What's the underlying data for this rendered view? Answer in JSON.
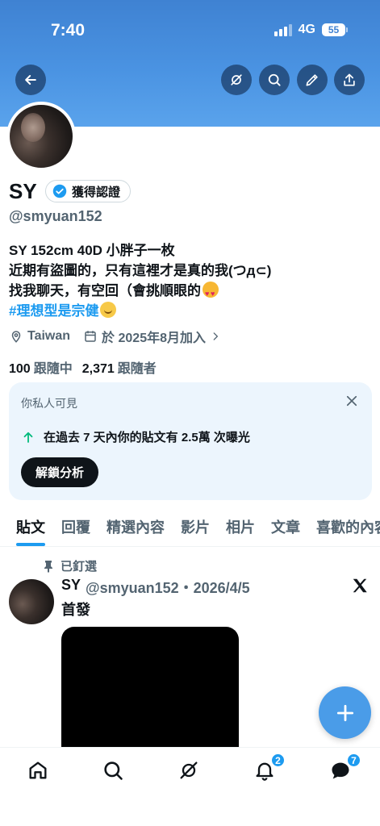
{
  "status_bar": {
    "time": "7:40",
    "network": "4G",
    "battery": "55"
  },
  "header": {
    "buttons": [
      {
        "name": "back-button",
        "icon": "arrow-left-icon"
      },
      {
        "name": "grok-button",
        "icon": "grok-icon"
      },
      {
        "name": "search-button",
        "icon": "search-icon"
      },
      {
        "name": "edit-button",
        "icon": "pencil-icon"
      },
      {
        "name": "share-button",
        "icon": "share-icon"
      }
    ]
  },
  "profile": {
    "name": "SY",
    "verified_label": "獲得認證",
    "handle": "@smyuan152",
    "bio": {
      "line1": "SY 152cm 40D 小胖子一枚",
      "line2": "近期有盜圖的，只有這裡才是真的我(つд⊂)",
      "line3": "找我聊天，有空回（會挑順眼的",
      "line4": "#理想型是宗健"
    },
    "location": "Taiwan",
    "joined": "於 2025年8月加入",
    "following_count": "100",
    "following_label": "跟隨中",
    "followers_count": "2,371",
    "followers_label": "跟隨者"
  },
  "insight_card": {
    "title": "你私人可見",
    "message": "在過去 7 天內你的貼文有 2.5萬 次曝光",
    "button": "解鎖分析"
  },
  "tabs": [
    "貼文",
    "回覆",
    "精選內容",
    "影片",
    "相片",
    "文章",
    "喜歡的內容"
  ],
  "post": {
    "pinned_label": "已釘選",
    "author": "SY",
    "meta": "@smyuan152・2026/4/5",
    "text": "首發"
  },
  "bottom_nav": {
    "notifications_badge": "2",
    "messages_badge": "7"
  },
  "colors": {
    "accent": "#1d9bf0",
    "banner": "#4a93e2",
    "fab": "#4a9ce8"
  }
}
